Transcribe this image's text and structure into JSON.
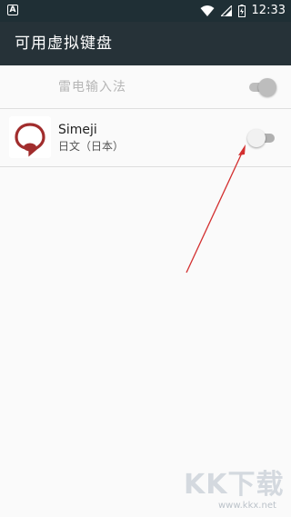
{
  "status_bar": {
    "notification_icon": "a-icon",
    "notification_letter": "A",
    "time": "12:33"
  },
  "app_bar": {
    "title": "可用虚拟键盘"
  },
  "keyboards": [
    {
      "name": "雷电输入法",
      "subtitle": "",
      "enabled": true,
      "disabled_row": true
    },
    {
      "name": "Simeji",
      "subtitle": "日文（日本）",
      "enabled": false,
      "disabled_row": false
    }
  ],
  "annotation": {
    "color": "#d32f2f"
  },
  "watermark": {
    "text": "KK下载",
    "url": "www.kkx.net"
  },
  "colors": {
    "status_bar": "#1f2f35",
    "app_bar": "#263238",
    "background": "#fafafa"
  }
}
